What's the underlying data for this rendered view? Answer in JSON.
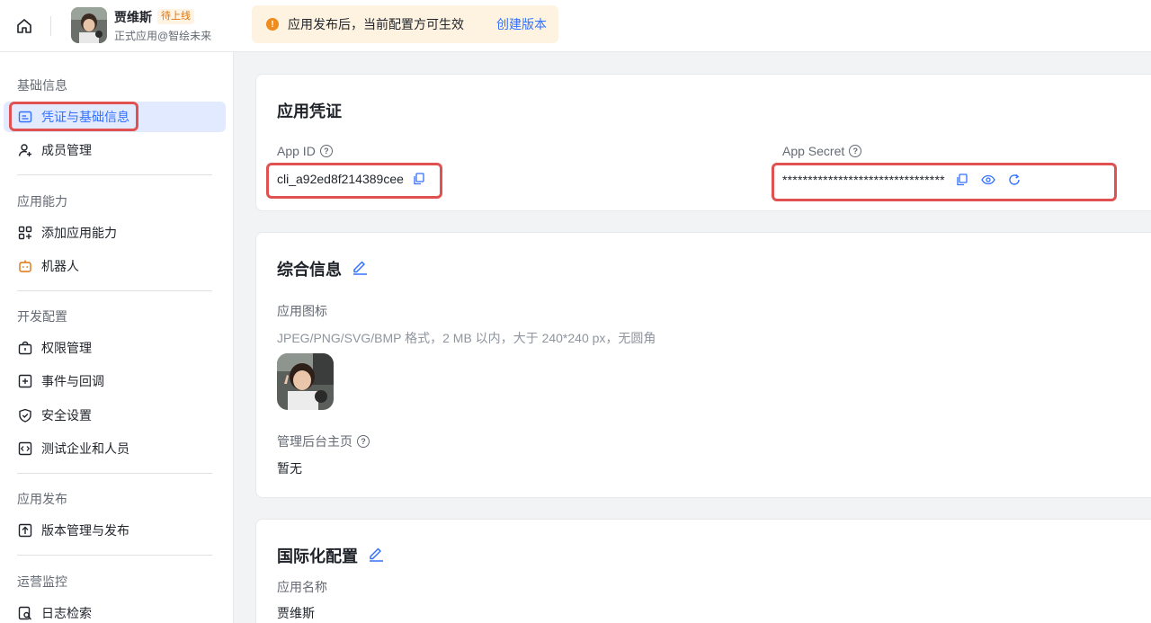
{
  "header": {
    "app_name": "贾维斯",
    "status_badge": "待上线",
    "app_subtitle": "正式应用@智绘未来",
    "notice_text": "应用发布后，当前配置方可生效",
    "notice_link": "创建版本"
  },
  "sidebar": {
    "groups": [
      {
        "title": "基础信息",
        "items": [
          {
            "label": "凭证与基础信息",
            "icon": "id-card-icon",
            "active": true
          },
          {
            "label": "成员管理",
            "icon": "user-add-icon"
          }
        ]
      },
      {
        "title": "应用能力",
        "items": [
          {
            "label": "添加应用能力",
            "icon": "apps-add-icon"
          },
          {
            "label": "机器人",
            "icon": "robot-icon"
          }
        ]
      },
      {
        "title": "开发配置",
        "items": [
          {
            "label": "权限管理",
            "icon": "lock-box-icon"
          },
          {
            "label": "事件与回调",
            "icon": "event-plus-icon"
          },
          {
            "label": "安全设置",
            "icon": "shield-icon"
          },
          {
            "label": "测试企业和人员",
            "icon": "code-icon"
          }
        ]
      },
      {
        "title": "应用发布",
        "items": [
          {
            "label": "版本管理与发布",
            "icon": "upload-icon"
          }
        ]
      },
      {
        "title": "运营监控",
        "items": [
          {
            "label": "日志检索",
            "icon": "log-search-icon"
          }
        ]
      }
    ]
  },
  "credentials": {
    "title": "应用凭证",
    "app_id_label": "App ID",
    "app_id_value": "cli_a92ed8f214389cee",
    "app_secret_label": "App Secret",
    "app_secret_value": "********************************"
  },
  "general": {
    "title": "综合信息",
    "icon_label": "应用图标",
    "icon_hint": "JPEG/PNG/SVG/BMP 格式，2 MB 以内，大于 240*240 px，无圆角",
    "admin_home_label": "管理后台主页",
    "admin_home_value": "暂无"
  },
  "i18n": {
    "title": "国际化配置",
    "app_name_label": "应用名称",
    "app_name_value": "贾维斯"
  },
  "colors": {
    "accent": "#3370ff",
    "highlight_border": "#e05252",
    "badge": "#e0740b"
  }
}
